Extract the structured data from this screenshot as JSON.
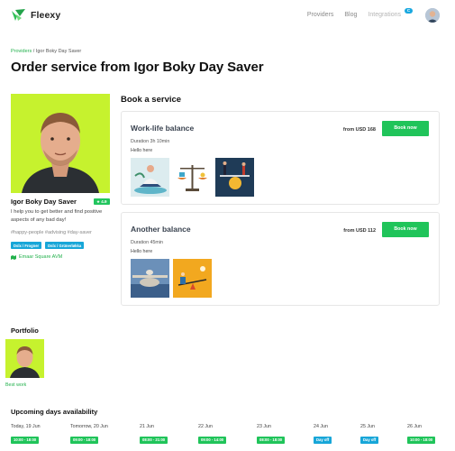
{
  "header": {
    "brand": "Fleexy",
    "nav": [
      "Providers",
      "Blog",
      "Integrations"
    ],
    "integrations_badge": "C"
  },
  "breadcrumb": {
    "parent": "Providers",
    "separator": "/",
    "current": "Igor Boky Day Saver"
  },
  "page_title": "Order service from Igor Boky Day Saver",
  "profile": {
    "name": "Igor Boky Day Saver",
    "rating": "4.9",
    "bio": "I help you to get better and find positive aspects of any bad day!",
    "hashtags": "#happy-people #advising #day-saver",
    "chips": [
      "Dslx / Frogner",
      "Dslx / Grünerløkka"
    ],
    "location": "Emaar Square AVM"
  },
  "book_section_title": "Book a service",
  "services": [
    {
      "name": "Work-life balance",
      "duration": "Duration 3h 10min",
      "description": "Hello here",
      "price": "from USD 168",
      "cta": "Book now",
      "images": [
        "meditation-illustration",
        "scales-illustration",
        "coin-balance-illustration"
      ]
    },
    {
      "name": "Another balance",
      "duration": "Duration 45min",
      "description": "Hello here",
      "price": "from USD 112",
      "cta": "Book now",
      "images": [
        "stone-balance-photo",
        "seesaw-illustration"
      ]
    }
  ],
  "portfolio": {
    "title": "Portfolio",
    "caption": "Best work"
  },
  "availability": {
    "title": "Upcoming days availability",
    "days": [
      {
        "label": "Today, 19 Jun",
        "slot": "10:00 - 18:00",
        "off": false
      },
      {
        "label": "Tomorrow, 20 Jun",
        "slot": "09:00 - 18:00",
        "off": false
      },
      {
        "label": "21 Jun",
        "slot": "08:00 - 21:00",
        "off": false
      },
      {
        "label": "22 Jun",
        "slot": "09:00 - 14:00",
        "off": false
      },
      {
        "label": "23 Jun",
        "slot": "08:00 - 18:00",
        "off": false
      },
      {
        "label": "24 Jun",
        "slot": "Day off",
        "off": true
      },
      {
        "label": "25 Jun",
        "slot": "Day off",
        "off": true
      },
      {
        "label": "26 Jun",
        "slot": "10:00 - 18:00",
        "off": false
      }
    ]
  },
  "colors": {
    "accent_green": "#20c45a",
    "chip_blue": "#17a6d8",
    "photo_lime": "#c6f22e"
  }
}
